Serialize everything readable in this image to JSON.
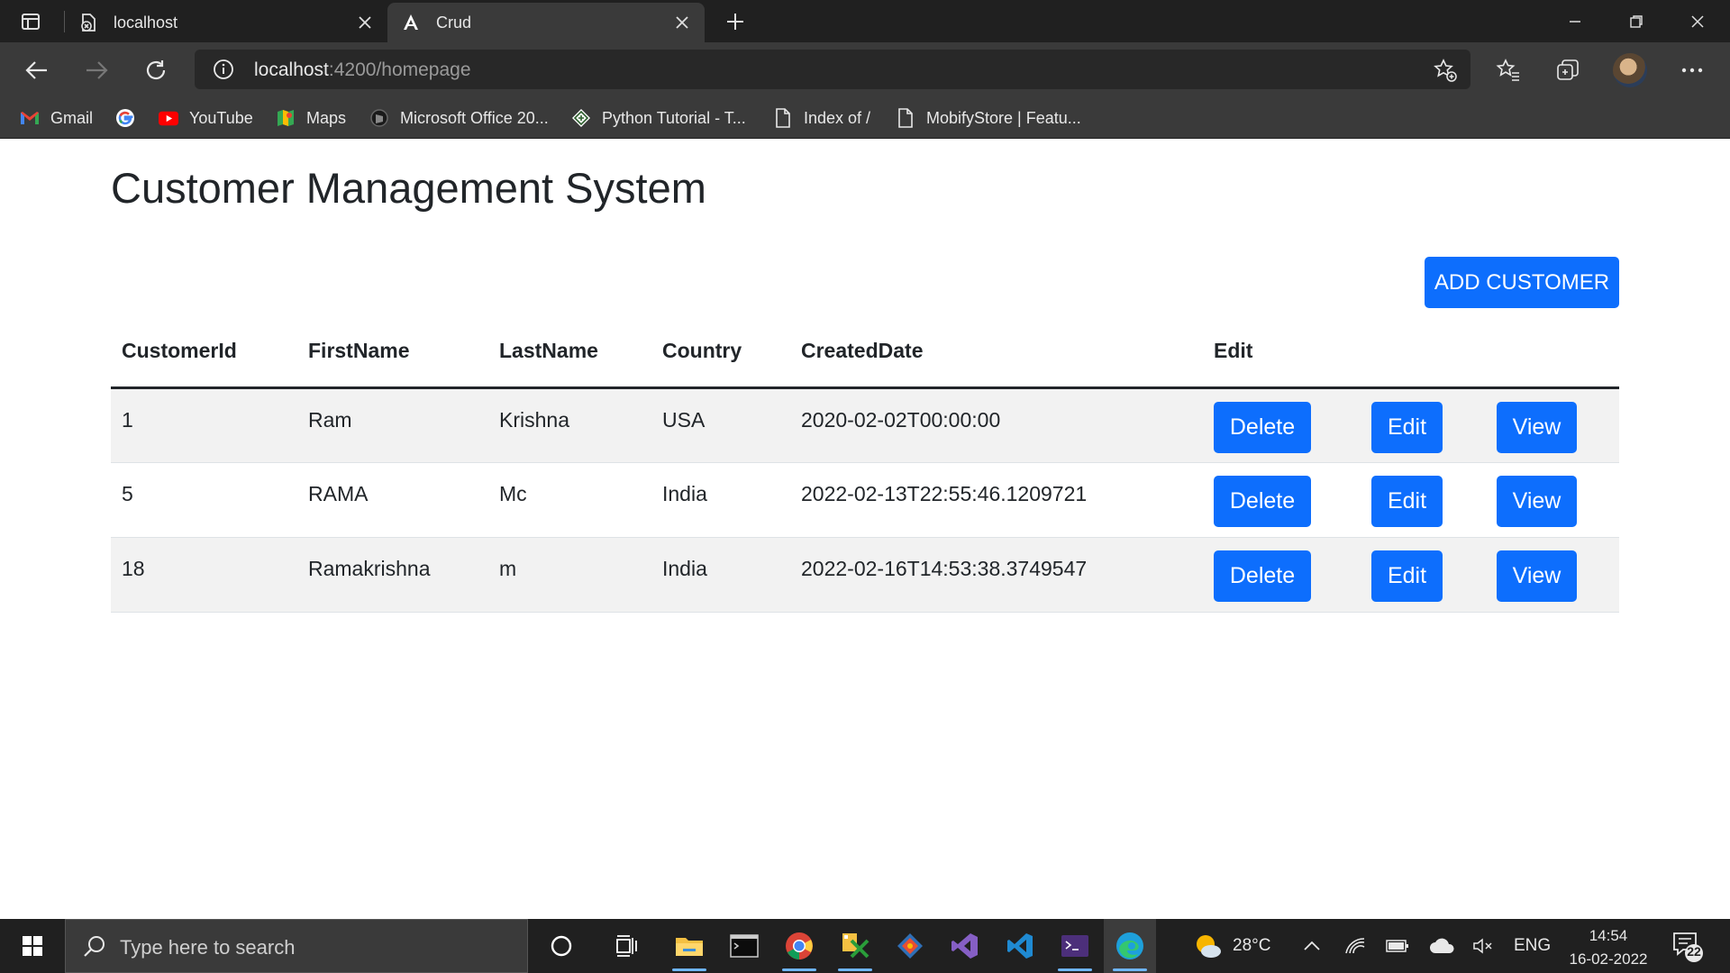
{
  "browser": {
    "tabs": [
      {
        "title": "localhost",
        "active": false
      },
      {
        "title": "Crud",
        "active": true
      }
    ],
    "address": {
      "host": "localhost",
      "rest": ":4200/homepage"
    },
    "bookmarks": [
      {
        "label": "Gmail",
        "icon": "gmail-icon"
      },
      {
        "label": "",
        "icon": "google-icon"
      },
      {
        "label": "YouTube",
        "icon": "youtube-icon"
      },
      {
        "label": "Maps",
        "icon": "maps-icon"
      },
      {
        "label": "Microsoft Office 20...",
        "icon": "office-icon"
      },
      {
        "label": "Python Tutorial - T...",
        "icon": "python-tutorial-icon"
      },
      {
        "label": "Index of /",
        "icon": "page-icon"
      },
      {
        "label": "MobifyStore | Featu...",
        "icon": "page-icon"
      }
    ]
  },
  "page": {
    "title": "Customer Management System",
    "add_button": "ADD CUSTOMER",
    "columns": [
      "CustomerId",
      "FirstName",
      "LastName",
      "Country",
      "CreatedDate",
      "Edit"
    ],
    "rows": [
      {
        "id": "1",
        "first": "Ram",
        "last": "Krishna",
        "country": "USA",
        "created": "2020-02-02T00:00:00"
      },
      {
        "id": "5",
        "first": "RAMA",
        "last": "Mc",
        "country": "India",
        "created": "2022-02-13T22:55:46.1209721"
      },
      {
        "id": "18",
        "first": "Ramakrishna",
        "last": "m",
        "country": "India",
        "created": "2022-02-16T14:53:38.3749547"
      }
    ],
    "actions": {
      "delete": "Delete",
      "edit": "Edit",
      "view": "View"
    }
  },
  "taskbar": {
    "search_placeholder": "Type here to search",
    "weather": "28°C",
    "language": "ENG",
    "time": "14:54",
    "date": "16-02-2022",
    "notifications": "22"
  },
  "colors": {
    "primary": "#0d6efd",
    "chrome_dark": "#202020",
    "chrome": "#3a3a3a"
  }
}
